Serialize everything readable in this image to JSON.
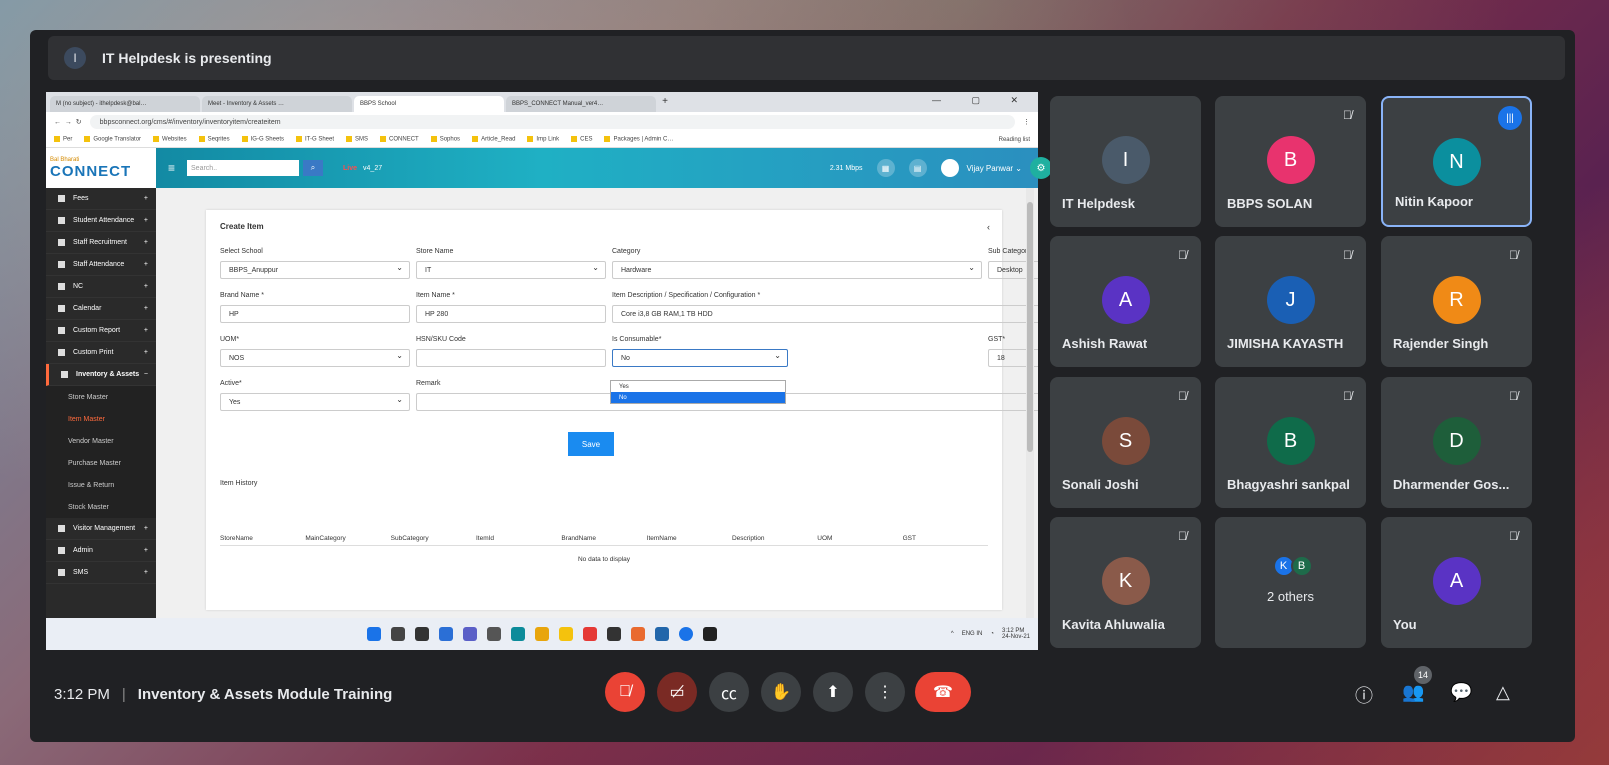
{
  "presenting": {
    "avatar_letter": "I",
    "text": "IT Helpdesk is presenting"
  },
  "browser": {
    "tabs": [
      "M (no subject) - ithelpdesk@bal…",
      "Meet - Inventory & Assets …",
      "BBPS School",
      "BBPS_CONNECT Manual_ver4…"
    ],
    "new_tab": "+",
    "url": "bbpsconnect.org/cms/#/inventory/inventoryitem/createitem",
    "bookmarks": [
      "Per",
      "Google Translator",
      "Websites",
      "Seqrites",
      "IG-G Sheets",
      "IT-G Sheet",
      "SMS",
      "CONNECT",
      "Sophos",
      "Article_Read",
      "Imp Link",
      "CES",
      "Packages | Admin C…"
    ],
    "reading_list": "Reading list"
  },
  "app": {
    "logo_small": "Bal Bharati",
    "logo_big": "CONNECT",
    "search_placeholder": "Search..",
    "version_label": "v4_27",
    "version_tag": "Live",
    "speed": "2.31 Mbps",
    "user_name": "Vijay Panwar",
    "sidebar": [
      {
        "label": "Fees"
      },
      {
        "label": "Student Attendance"
      },
      {
        "label": "Staff Recruitment"
      },
      {
        "label": "Staff Attendance"
      },
      {
        "label": "NC"
      },
      {
        "label": "Calendar"
      },
      {
        "label": "Custom Report"
      },
      {
        "label": "Custom Print"
      },
      {
        "label": "Inventory & Assets"
      }
    ],
    "sidebar_sub": [
      {
        "label": "Store Master"
      },
      {
        "label": "Item Master"
      },
      {
        "label": "Vendor Master"
      },
      {
        "label": "Purchase Master"
      },
      {
        "label": "Issue & Return"
      },
      {
        "label": "Stock Master"
      }
    ],
    "sidebar_after": [
      {
        "label": "Visitor Management"
      },
      {
        "label": "Admin"
      },
      {
        "label": "SMS"
      }
    ],
    "form": {
      "title": "Create Item",
      "labels": [
        "Select School",
        "Store Name",
        "Category",
        "Sub Category",
        "Brand Name *",
        "Item Name *",
        "Item Description / Specification / Configuration *",
        "UOM*",
        "HSN/SKU Code",
        "Is Consumable*",
        "GST*",
        "Active*",
        "Remark"
      ],
      "values": {
        "school": "BBPS_Anuppur",
        "store": "IT",
        "category": "Hardware",
        "subcategory": "Desktop",
        "brand": "HP",
        "item": "HP 280",
        "desc": "Core i3,8 GB RAM,1 TB HDD",
        "uom": "NOS",
        "hsn": "",
        "consumable": "No",
        "gst": "18",
        "active": "Yes",
        "remark": ""
      },
      "dropdown_options": [
        "Yes",
        "No"
      ],
      "save": "Save",
      "history_title": "Item History",
      "columns": [
        "StoreName",
        "MainCategory",
        "SubCategory",
        "ItemId",
        "BrandName",
        "ItemName",
        "Description",
        "UOM",
        "GST"
      ],
      "no_data": "No data to display"
    },
    "tray": {
      "lang": "ENG IN",
      "time": "3:12 PM",
      "date": "24-Nov-21"
    }
  },
  "participants": [
    {
      "name": "IT Helpdesk",
      "letter": "I",
      "color": "#4a5a6a",
      "muted": false
    },
    {
      "name": "BBPS SOLAN",
      "letter": "B",
      "color": "#e8336e",
      "muted": true
    },
    {
      "name": "Nitin Kapoor",
      "letter": "N",
      "color": "#0b8f9e",
      "muted": false,
      "speaking": true
    },
    {
      "name": "Ashish Rawat",
      "letter": "A",
      "color": "#5a33c4",
      "muted": true
    },
    {
      "name": "JIMISHA KAYASTH",
      "letter": "J",
      "color": "#1a5fb4",
      "muted": true
    },
    {
      "name": "Rajender Singh",
      "letter": "R",
      "color": "#f08a16",
      "muted": true
    },
    {
      "name": "Sonali Joshi",
      "letter": "S",
      "color": "#7a4a3a",
      "muted": true
    },
    {
      "name": "Bhagyashri sankpal",
      "letter": "B",
      "color": "#0f6b4a",
      "muted": true
    },
    {
      "name": "Dharmender Gos...",
      "letter": "D",
      "color": "#1e5e3a",
      "muted": true
    },
    {
      "name": "Kavita Ahluwalia",
      "letter": "K",
      "color": "#8a5a4a",
      "muted": true
    },
    {
      "name": "2 others",
      "letters": [
        "K",
        "B"
      ],
      "colors": [
        "#1a73e8",
        "#1e6b4a"
      ],
      "muted": false
    },
    {
      "name": "You",
      "letter": "A",
      "color": "#5a33c4",
      "muted": true
    }
  ],
  "bottom": {
    "time": "3:12 PM",
    "separator": "|",
    "title": "Inventory & Assets Module Training",
    "people_count": "14"
  },
  "icons": {
    "mic_off": "mic-off-icon",
    "cam_off": "camera-off-icon",
    "captions": "cc-icon",
    "hand": "hand-icon",
    "present": "present-icon",
    "more": "more-icon",
    "hangup": "hangup-icon"
  }
}
